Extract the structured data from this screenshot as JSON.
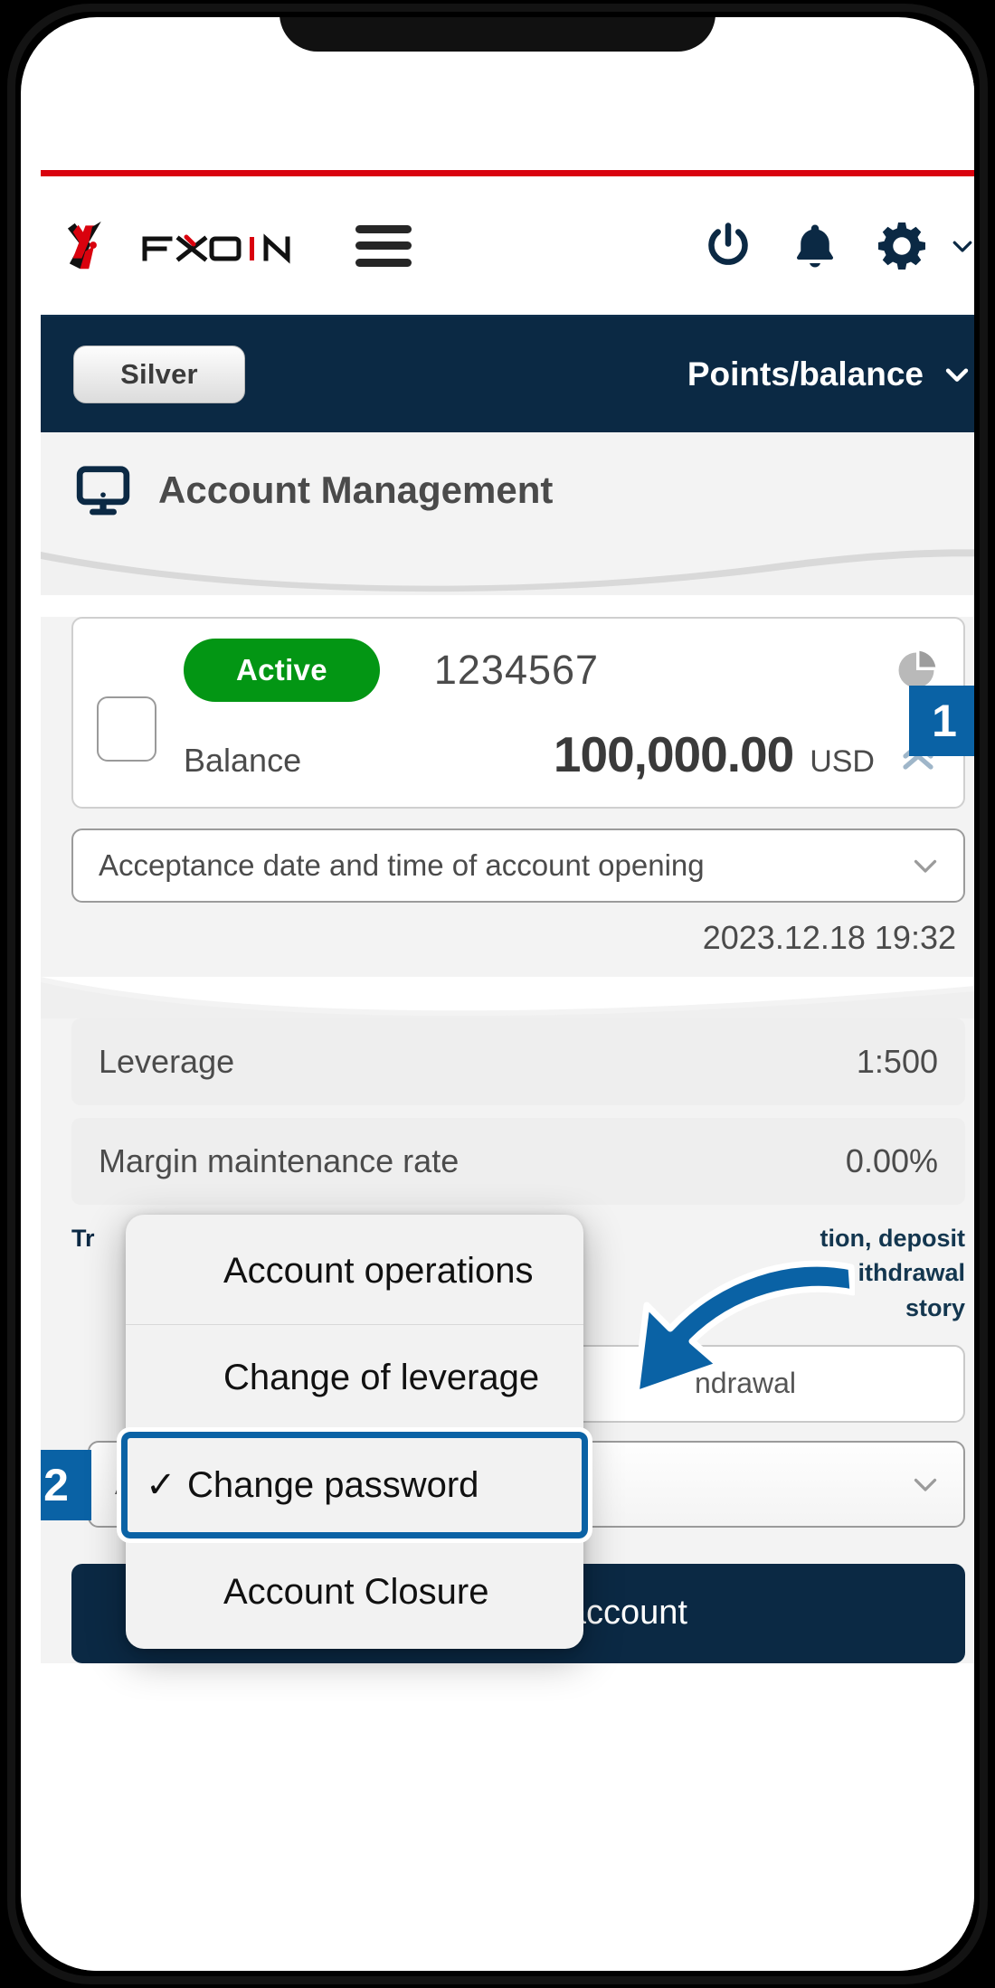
{
  "brand": {
    "logo_text": "FXON",
    "accent_red": "#d9020e",
    "navy": "#0b2944",
    "blue": "#0a62a5",
    "green": "#039614"
  },
  "header": {
    "menu_icon": "hamburger-icon",
    "power_icon": "power-icon",
    "bell_icon": "bell-icon",
    "gear_icon": "gear-icon",
    "caret_icon": "chevron-down-icon"
  },
  "subbar": {
    "tier_label": "Silver",
    "points_label": "Points/balance",
    "points_caret_icon": "chevron-down-icon"
  },
  "page": {
    "title": "Account Management",
    "title_icon": "monitor-icon"
  },
  "account_card": {
    "status_label": "Active",
    "account_number": "1234567",
    "balance_label": "Balance",
    "balance_value": "100,000.00",
    "currency": "USD",
    "pie_icon": "pie-chart-icon",
    "expand_icon": "chevron-double-up-icon",
    "checkbox_name": "account-select-checkbox",
    "badge": "1"
  },
  "opening_field": {
    "label": "Acceptance date and time of account opening",
    "caret_icon": "chevron-down-icon",
    "value": "2023.12.18 19:32"
  },
  "info_rows": [
    {
      "label": "Leverage",
      "value": "1:500"
    },
    {
      "label": "Margin maintenance rate",
      "value": "0.00%"
    }
  ],
  "trading_block": {
    "label": "Tr",
    "desc_lines": [
      "tion, deposit",
      "ithdrawal",
      "story"
    ]
  },
  "withdrawal_row": {
    "right_pill": "ndrawal"
  },
  "operations_select": {
    "value": "Account operations",
    "caret_icon": "chevron-down-icon",
    "badge": "2"
  },
  "demo_button": {
    "label": "Open a demo account"
  },
  "select_popup": {
    "options": [
      {
        "label": "Account operations",
        "selected": false
      },
      {
        "label": "Change of leverage",
        "selected": false
      },
      {
        "label": "Change password",
        "selected": true
      },
      {
        "label": "Account Closure",
        "selected": false
      }
    ],
    "check_glyph": "✓"
  },
  "annotation": {
    "arrow_icon": "curved-arrow-icon",
    "arrow_color": "#0a62a5"
  }
}
